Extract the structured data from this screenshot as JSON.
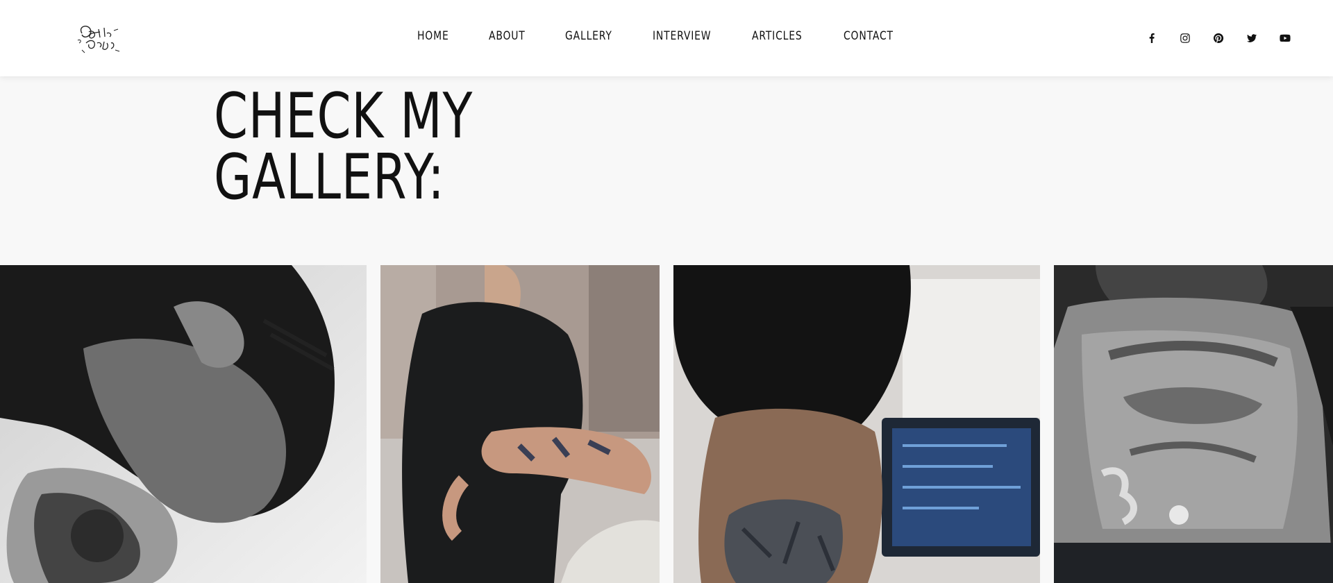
{
  "brand": {
    "logo_text": "Better Days"
  },
  "nav": {
    "items": [
      "HOME",
      "ABOUT",
      "GALLERY",
      "INTERVIEW",
      "ARTICLES",
      "CONTACT"
    ]
  },
  "social": [
    "facebook-icon",
    "instagram-icon",
    "pinterest-icon",
    "twitter-icon",
    "youtube-icon"
  ],
  "hero": {
    "title_line1": "CHECK MY",
    "title_line2": "GALLERY:"
  },
  "gallery": {
    "photos": [
      "man-praying-neck-tattoo",
      "man-black-tshirt-arm-tattoos",
      "woman-neck-tattoo-laptop",
      "man-full-body-tattoos"
    ]
  },
  "colors": {
    "header_bg": "#ffffff",
    "page_bg": "#f8f8f8",
    "text": "#111111"
  }
}
